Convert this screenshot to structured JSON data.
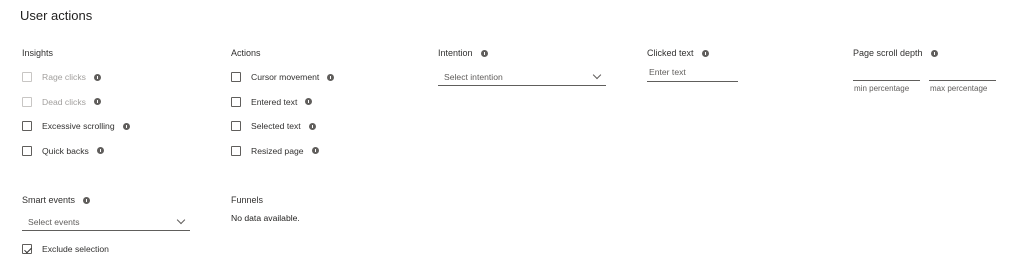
{
  "title": "User actions",
  "insights": {
    "header": "Insights",
    "items": [
      {
        "label": "Rage clicks",
        "checked": false,
        "disabled": true
      },
      {
        "label": "Dead clicks",
        "checked": false,
        "disabled": true
      },
      {
        "label": "Excessive scrolling",
        "checked": false,
        "disabled": false
      },
      {
        "label": "Quick backs",
        "checked": false,
        "disabled": false
      }
    ]
  },
  "actions": {
    "header": "Actions",
    "items": [
      {
        "label": "Cursor movement",
        "checked": false
      },
      {
        "label": "Entered text",
        "checked": false
      },
      {
        "label": "Selected text",
        "checked": false
      },
      {
        "label": "Resized page",
        "checked": false
      }
    ]
  },
  "intention": {
    "header": "Intention",
    "placeholder": "Select intention"
  },
  "clicked_text": {
    "header": "Clicked text",
    "placeholder": "Enter text"
  },
  "scroll_depth": {
    "header": "Page scroll depth",
    "min_label": "min percentage",
    "max_label": "max percentage"
  },
  "smart_events": {
    "header": "Smart events",
    "placeholder": "Select events",
    "exclude_label": "Exclude selection",
    "exclude_checked": true
  },
  "funnels": {
    "header": "Funnels",
    "empty_text": "No data available."
  },
  "icons": {
    "info": "info-icon",
    "chevron": "chevron-down-icon",
    "check": "checkmark-icon"
  }
}
